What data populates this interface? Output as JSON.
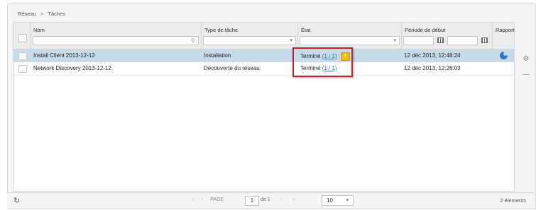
{
  "breadcrumb": {
    "root": "Réseau",
    "separator": ">",
    "current": "Tâches"
  },
  "columns": {
    "name": "Nom",
    "task_type": "Type de tâche",
    "state": "État",
    "start_period": "Période de début",
    "report": "Rapport"
  },
  "rows": [
    {
      "name": "Install Client 2013-12-12",
      "task_type": "Installation",
      "state_text": "Terminé",
      "state_link": "(1 / 1)",
      "warning": "!",
      "start": "12 déc 2013, 12:48:24",
      "selected": true
    },
    {
      "name": "Network Discovery 2013-12-12",
      "task_type": "Découverte du réseau",
      "state_text": "Terminé",
      "state_link": "(1 / 1)",
      "start": "12 déc 2013, 12:26:03",
      "selected": false
    }
  ],
  "pagination": {
    "page_label": "PAGE",
    "page_value": "1",
    "of_label": "de 1",
    "per_page": "10",
    "count": "2 éléments"
  },
  "colors": {
    "accent": "#2b78c2",
    "selected_row": "#c5dbe9",
    "highlight": "#c0272d",
    "warning": "#f3b81f"
  },
  "icons": [
    "search-icon",
    "calendar-icon",
    "report-chart-icon",
    "settings-icon",
    "collapse-icon",
    "refresh-icon",
    "warning-icon"
  ]
}
